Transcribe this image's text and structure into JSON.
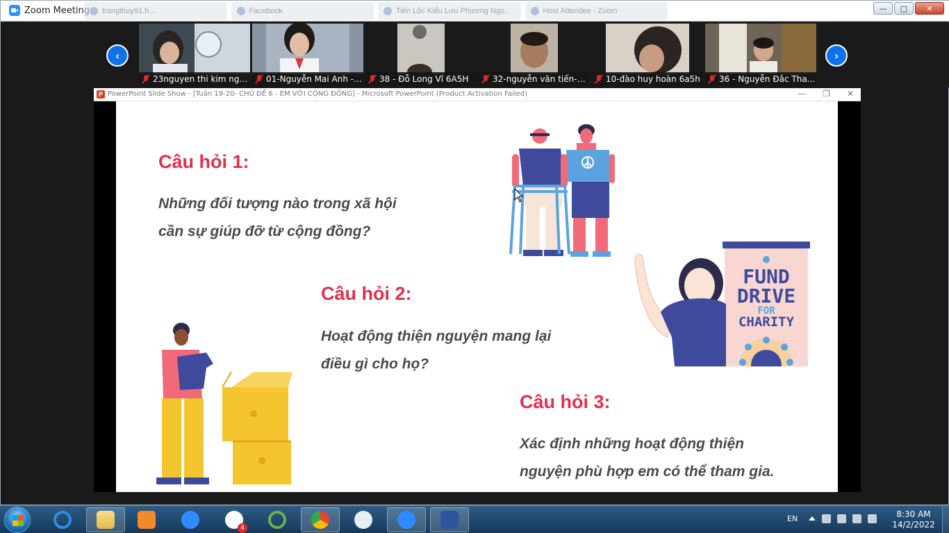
{
  "zoom": {
    "title": "Zoom Meeting",
    "browser_tabs": [
      "trangthuy91.h...",
      "Facebook",
      "Tiến Lộc Kiểu Lưu Phương Ngọ...",
      "Host Attendee - Zoom"
    ],
    "controls": {
      "minimize": "—",
      "maximize": "□",
      "close": "✕"
    },
    "nav_prev": "‹",
    "nav_next": "›",
    "participants": [
      {
        "name": "23nguyen thi kim nga...",
        "muted": true
      },
      {
        "name": "01-Nguyễn Mai Anh -...",
        "muted": true
      },
      {
        "name": "38 - Đỗ Long Vĩ 6A5H",
        "muted": true
      },
      {
        "name": "32-nguyễn văn tiến-6...",
        "muted": true
      },
      {
        "name": "10-đào huy hoàn 6a5h",
        "muted": true
      },
      {
        "name": "36 - Nguyễn Đắc Tha...",
        "muted": true
      }
    ]
  },
  "ppt": {
    "title": "PowerPoint Slide Show - [Tuần 19-20- CHỦ ĐỀ 6 - EM VỚI CỘNG ĐỒNG] - Microsoft PowerPoint (Product Activation Failed)",
    "icon_letter": "P",
    "controls": {
      "minimize": "—",
      "restore": "❐",
      "close": "✕"
    }
  },
  "slide": {
    "q1_title": "Câu hỏi 1:",
    "q1_line1": "Những đối tượng nào trong xã hội",
    "q1_line2": "cần sự giúp đỡ từ cộng đồng?",
    "q2_title": "Câu hỏi 2:",
    "q2_line1": "Hoạt động thiện nguyện mang lại",
    "q2_line2": "điều gì cho họ?",
    "q3_title": "Câu hỏi 3:",
    "q3_line1": "Xác định những hoạt động thiện",
    "q3_line2": "nguyện phù hợp em có thể tham gia.",
    "poster_line1": "FUND",
    "poster_line2": "DRIVE",
    "poster_line3": "FOR",
    "poster_line4": "CHARITY",
    "colors": {
      "question_title": "#e0304c",
      "question_body": "#4a4a4a",
      "navy": "#3f4a9c",
      "pink": "#f06a7a",
      "yellow": "#f5c530",
      "light_blue": "#5aa3e0"
    }
  },
  "taskbar": {
    "zalo_badge": "4",
    "language": "EN",
    "time": "8:30 AM",
    "date": "14/2/2022"
  }
}
